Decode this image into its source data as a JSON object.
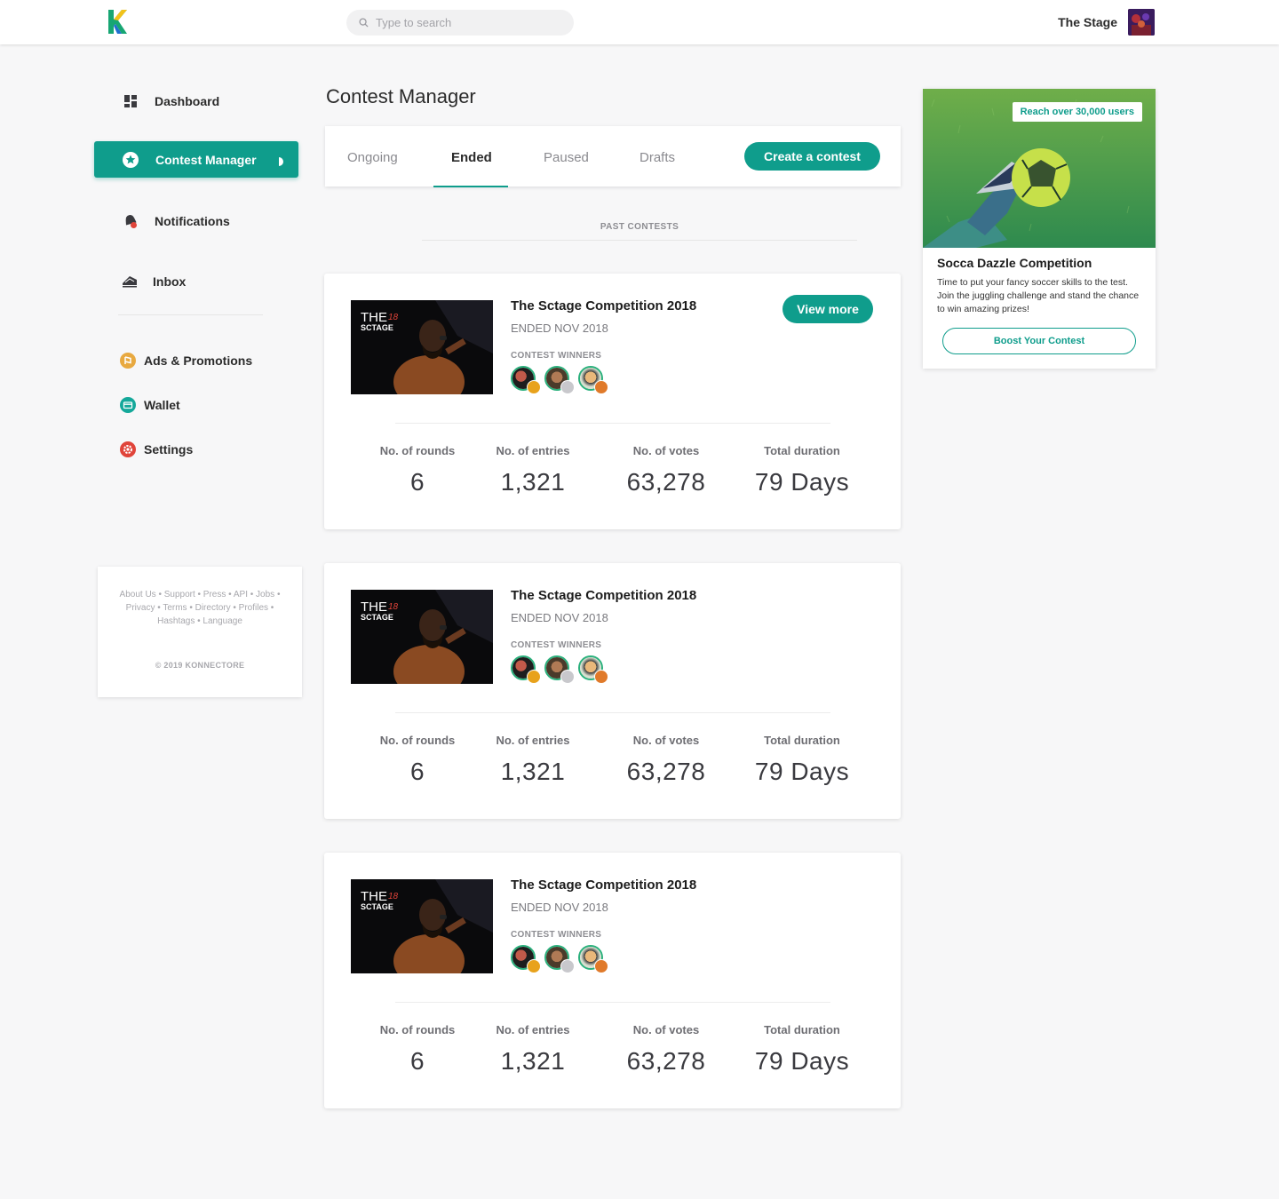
{
  "header": {
    "search_placeholder": "Type to search",
    "user_name": "The Stage"
  },
  "sidebar": {
    "items": [
      {
        "label": "Dashboard",
        "icon": "dashboard-icon"
      },
      {
        "label": "Contest Manager",
        "icon": "star-icon",
        "active": true
      },
      {
        "label": "Notifications",
        "icon": "bell-icon"
      },
      {
        "label": "Inbox",
        "icon": "inbox-icon"
      },
      {
        "label": "Ads & Promotions",
        "icon": "megaphone-icon"
      },
      {
        "label": "Wallet",
        "icon": "wallet-icon"
      },
      {
        "label": "Settings",
        "icon": "gear-icon"
      }
    ],
    "footer": {
      "links": "About Us • Support • Press • API • Jobs • Privacy • Terms • Directory • Profiles • Hashtags • Language",
      "copyright": "© 2019 KONNECTORE"
    }
  },
  "main": {
    "title": "Contest Manager",
    "tabs": [
      "Ongoing",
      "Ended",
      "Paused",
      "Drafts"
    ],
    "active_tab": "Ended",
    "create_button": "Create a contest",
    "section_label": "PAST CONTESTS",
    "contests": [
      {
        "title": "The Sctage Competition 2018",
        "status": "ENDED NOV 2018",
        "winners_label": "CONTEST WINNERS",
        "view_more": "View more",
        "thumb_text": "THE",
        "thumb_sub": "SCTAGE",
        "thumb_year": "18",
        "stats": [
          {
            "label": "No. of rounds",
            "value": "6"
          },
          {
            "label": "No. of entries",
            "value": "1,321"
          },
          {
            "label": "No. of votes",
            "value": "63,278"
          },
          {
            "label": "Total duration",
            "value": "79 Days"
          }
        ]
      },
      {
        "title": "The Sctage Competition 2018",
        "status": "ENDED NOV 2018",
        "winners_label": "CONTEST WINNERS",
        "thumb_text": "THE",
        "thumb_sub": "SCTAGE",
        "thumb_year": "18",
        "stats": [
          {
            "label": "No. of rounds",
            "value": "6"
          },
          {
            "label": "No. of entries",
            "value": "1,321"
          },
          {
            "label": "No. of votes",
            "value": "63,278"
          },
          {
            "label": "Total duration",
            "value": "79 Days"
          }
        ]
      },
      {
        "title": "The Sctage Competition 2018",
        "status": "ENDED NOV 2018",
        "winners_label": "CONTEST WINNERS",
        "thumb_text": "THE",
        "thumb_sub": "SCTAGE",
        "thumb_year": "18",
        "stats": [
          {
            "label": "No. of rounds",
            "value": "6"
          },
          {
            "label": "No. of entries",
            "value": "1,321"
          },
          {
            "label": "No. of votes",
            "value": "63,278"
          },
          {
            "label": "Total duration",
            "value": "79 Days"
          }
        ]
      }
    ]
  },
  "ad": {
    "badge": "Reach over 30,000 users",
    "title": "Socca Dazzle Competition",
    "description": "Time to put your fancy soccer skills to the test. Join the juggling challenge and stand the chance to win amazing prizes!",
    "button": "Boost Your Contest"
  },
  "colors": {
    "accent": "#0f9d8c",
    "background": "#f7f7f8",
    "gold_medal": "#e8a21c",
    "silver_medal": "#c8c8cc",
    "bronze_medal": "#e07a2a"
  }
}
